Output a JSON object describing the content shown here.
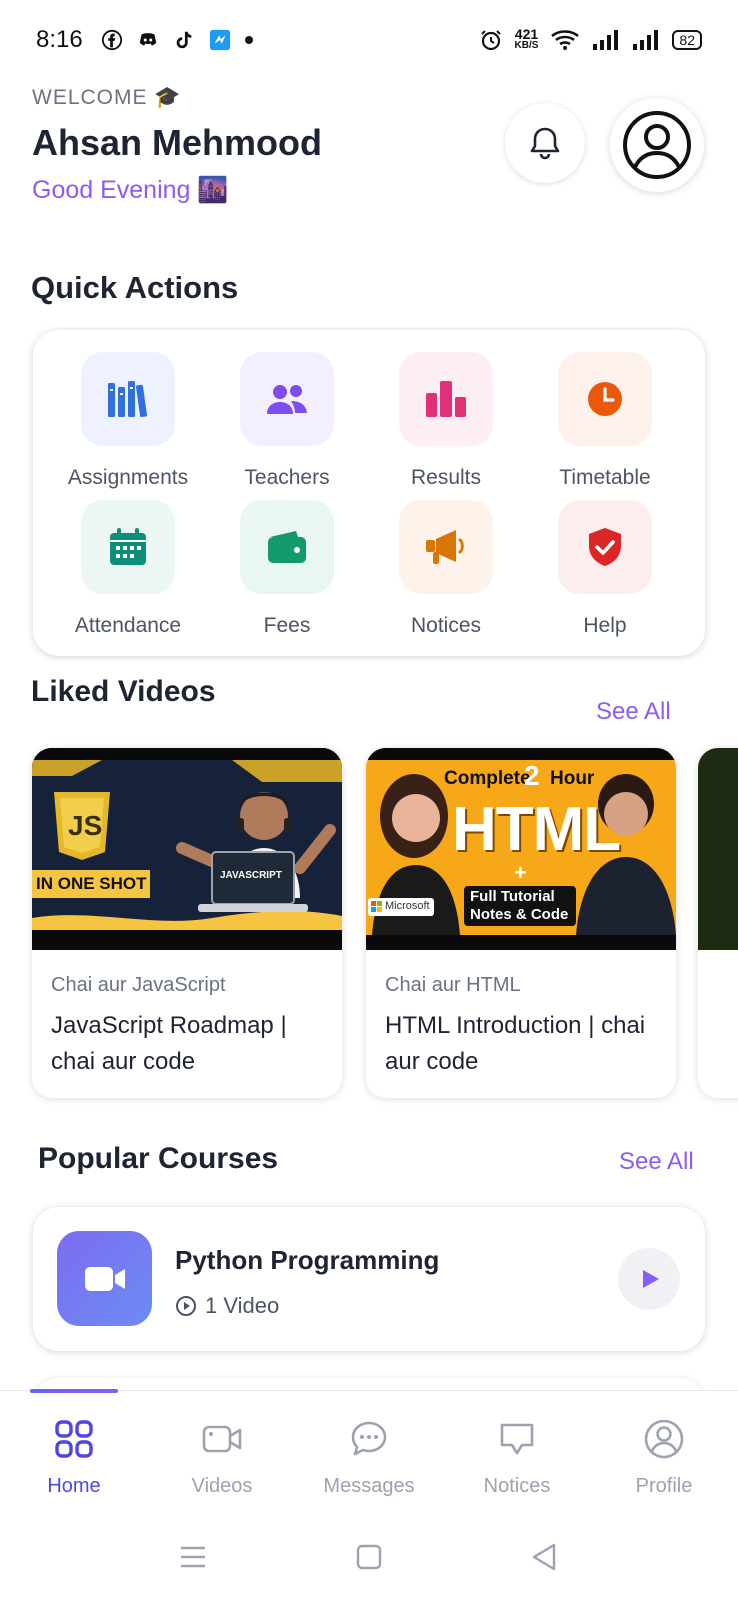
{
  "status_bar": {
    "time": "8:16",
    "net_speed": "421",
    "net_unit": "KB/S",
    "battery": "82",
    "app_icons": [
      "facebook-icon",
      "discord-icon",
      "tiktok-icon",
      "app-icon",
      "dot-icon"
    ],
    "system_icons": [
      "alarm-icon",
      "wifi-icon",
      "signal-icon",
      "signal-icon"
    ]
  },
  "header": {
    "welcome": "WELCOME 🎓",
    "name": "Ahsan Mehmood",
    "greeting": "Good Evening 🌆"
  },
  "quick_actions": {
    "title": "Quick Actions",
    "items": [
      {
        "label": "Assignments",
        "icon": "books-icon",
        "tile_color": "#eef2ff",
        "icon_color": "#2f6fe0"
      },
      {
        "label": "Teachers",
        "icon": "people-icon",
        "tile_color": "#f3efff",
        "icon_color": "#7c4df0"
      },
      {
        "label": "Results",
        "icon": "bar-chart-icon",
        "tile_color": "#fdeef3",
        "icon_color": "#e0307a"
      },
      {
        "label": "Timetable",
        "icon": "clock-icon",
        "tile_color": "#fdf1ec",
        "icon_color": "#ea580c"
      },
      {
        "label": "Attendance",
        "icon": "calendar-icon",
        "tile_color": "#ecf7f4",
        "icon_color": "#0f8f7a"
      },
      {
        "label": "Fees",
        "icon": "wallet-icon",
        "tile_color": "#eaf6f1",
        "icon_color": "#129a6c"
      },
      {
        "label": "Notices",
        "icon": "megaphone-icon",
        "tile_color": "#fdf3ea",
        "icon_color": "#d97706"
      },
      {
        "label": "Help",
        "icon": "shield-check-icon",
        "tile_color": "#fdeeee",
        "icon_color": "#dc2626"
      }
    ]
  },
  "liked_videos": {
    "title": "Liked Videos",
    "see_all": "See All",
    "items": [
      {
        "channel": "Chai aur JavaScript",
        "title": "JavaScript Roadmap | chai aur code",
        "thumb_badge": "JS",
        "thumb_caption": "IN ONE SHOT",
        "thumb_screen": "JAVASCRIPT"
      },
      {
        "channel": "Chai aur HTML",
        "title": "HTML Introduction | chai aur code",
        "thumb_top": "Complete",
        "thumb_num": "2",
        "thumb_hour": "Hour",
        "thumb_big": "HTML",
        "thumb_plus": "+",
        "thumb_note1": "Full Tutorial",
        "thumb_note2": "Notes & Code",
        "thumb_brand": "Microsoft"
      }
    ]
  },
  "popular_courses": {
    "title": "Popular Courses",
    "see_all": "See All",
    "items": [
      {
        "title": "Python Programming",
        "meta": "1 Video"
      }
    ]
  },
  "bottom_nav": {
    "items": [
      {
        "label": "Home",
        "icon": "grid-icon",
        "active": true
      },
      {
        "label": "Videos",
        "icon": "video-camera-icon",
        "active": false
      },
      {
        "label": "Messages",
        "icon": "chat-bubble-icon",
        "active": false
      },
      {
        "label": "Notices",
        "icon": "notice-icon",
        "active": false
      },
      {
        "label": "Profile",
        "icon": "user-circle-icon",
        "active": false
      }
    ]
  },
  "colors": {
    "accent": "#8b5cf6",
    "nav_active": "#4f46e5",
    "text_dark": "#1f2433",
    "text_muted": "#6b7280"
  }
}
